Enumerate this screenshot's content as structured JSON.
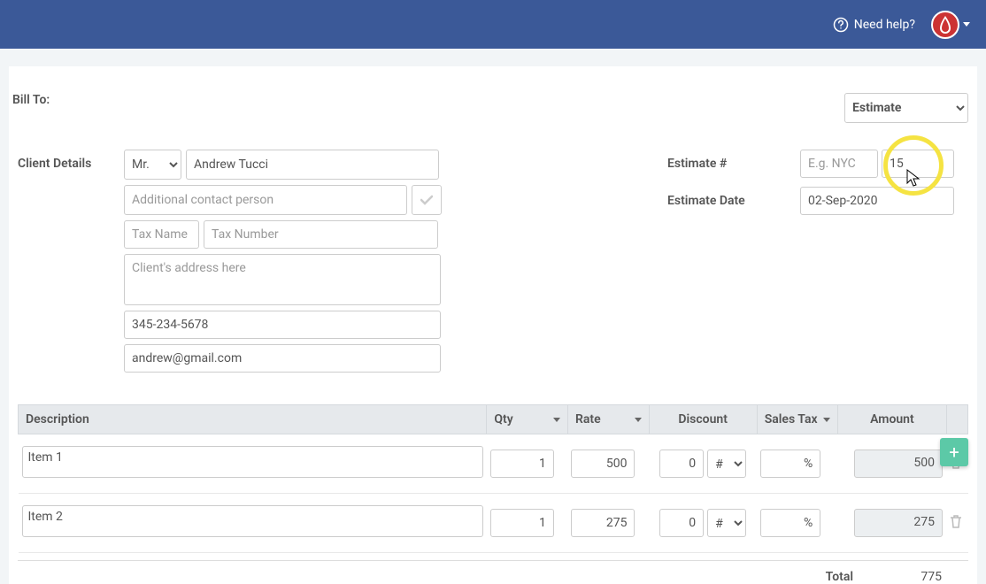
{
  "header": {
    "need_help": "Need help?"
  },
  "bill_to_label": "Bill To:",
  "doc_type": "Estimate",
  "client_details": {
    "label": "Client Details",
    "title": "Mr.",
    "name": "Andrew Tucci",
    "additional_contact_placeholder": "Additional contact person",
    "tax_name_placeholder": "Tax Name",
    "tax_number_placeholder": "Tax Number",
    "address_placeholder": "Client's address here",
    "phone": "345-234-5678",
    "email": "andrew@gmail.com"
  },
  "estimate": {
    "number_label": "Estimate #",
    "prefix_placeholder": "E.g. NYC",
    "number": "15",
    "date_label": "Estimate Date",
    "date": "02-Sep-2020"
  },
  "table": {
    "headers": {
      "description": "Description",
      "qty": "Qty",
      "rate": "Rate",
      "discount": "Discount",
      "sales_tax": "Sales Tax",
      "amount": "Amount"
    },
    "rows": [
      {
        "desc": "Item 1",
        "qty": "1",
        "rate": "500",
        "discount": "0",
        "disc_type": "#",
        "tax": "%",
        "amount": "500"
      },
      {
        "desc": "Item 2",
        "qty": "1",
        "rate": "275",
        "discount": "0",
        "disc_type": "#",
        "tax": "%",
        "amount": "275"
      }
    ]
  },
  "totals": {
    "total_label": "Total",
    "total_value": "775"
  }
}
